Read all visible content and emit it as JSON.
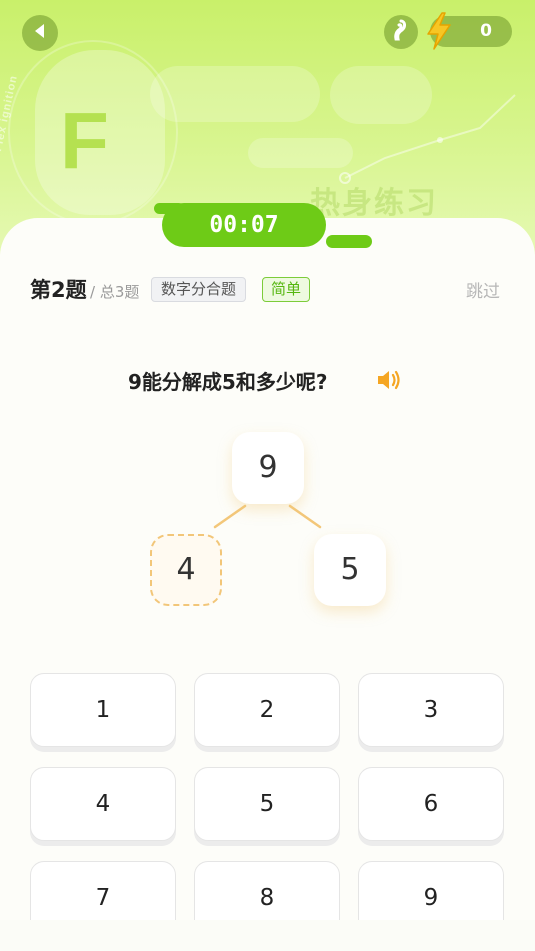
{
  "header": {
    "back_icon": "back-arrow-icon",
    "coin_icon": "coin-icon",
    "energy_icon": "lightning-icon",
    "energy_value": "0",
    "brand_ring_text": "Flex ignition",
    "brand_letter": "F",
    "banner_title": "热身练习"
  },
  "timer": {
    "value": "00:07"
  },
  "question_meta": {
    "index_label": "第2题",
    "total_label": "/ 总3题",
    "category_tag": "数字分合题",
    "level_tag": "简单",
    "skip_label": "跳过"
  },
  "question": {
    "text": "9能分解成5和多少呢?",
    "speaker_icon": "speaker-icon"
  },
  "tree": {
    "top": "9",
    "left": "4",
    "right": "5"
  },
  "keypad": {
    "keys": [
      "1",
      "2",
      "3",
      "4",
      "5",
      "6",
      "7",
      "8",
      "9"
    ]
  },
  "colors": {
    "accent_green": "#6ecb17",
    "hero_green": "#c9f06a",
    "bolt_yellow": "#f7c624",
    "speaker_orange": "#f5a623",
    "dashed_orange": "#f2c679"
  }
}
